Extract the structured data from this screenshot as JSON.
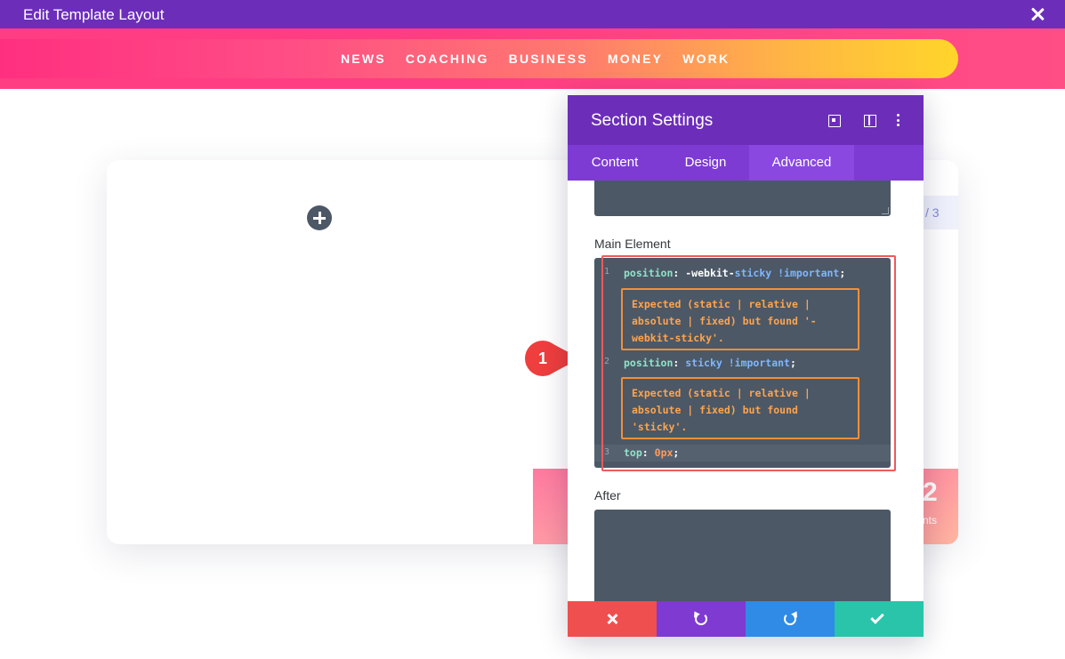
{
  "window": {
    "title": "Edit Template Layout",
    "close_icon": "close-icon"
  },
  "nav": {
    "items": [
      "NEWS",
      "COACHING",
      "BUSINESS",
      "MONEY",
      "WORK"
    ]
  },
  "canvas": {
    "add_icon": "plus-icon",
    "page_indicator": "/ 3",
    "stat_number": "2",
    "stat_label": "nts"
  },
  "callout": {
    "number": "1"
  },
  "modal": {
    "title": "Section Settings",
    "icons": [
      "expand-icon",
      "columns-icon",
      "more-dots-icon"
    ],
    "tabs": [
      {
        "label": "Content",
        "active": false
      },
      {
        "label": "Design",
        "active": false
      },
      {
        "label": "Advanced",
        "active": true
      }
    ],
    "main_element_label": "Main Element",
    "after_label": "After",
    "code": [
      {
        "num": "1",
        "prop": "position",
        "value_pre": "-webkit-",
        "value_kw": "sticky",
        "important": "!important"
      },
      {
        "num": "2",
        "prop": "position",
        "value_kw": "sticky",
        "important": "!important"
      },
      {
        "num": "3",
        "prop": "top",
        "value_num": "0px"
      }
    ],
    "lint_1": [
      "Expected (static | relative |",
      "absolute | fixed) but found '-",
      "webkit-sticky'."
    ],
    "lint_2": [
      "Expected (static | relative |",
      "absolute | fixed) but found",
      "'sticky'."
    ],
    "footer": [
      "cancel-icon",
      "undo-icon",
      "redo-icon",
      "save-check-icon"
    ]
  },
  "colors": {
    "title_bar": "#6c2eb9",
    "header_pink": "#ff3d82",
    "header_yellow": "#ffd52a",
    "cancel": "#ef4f4f",
    "undo": "#7e3ad1",
    "redo": "#2f8be6",
    "save": "#29c4a9",
    "callout_red": "#ef3e3e",
    "lint_orange": "#f2903a"
  }
}
